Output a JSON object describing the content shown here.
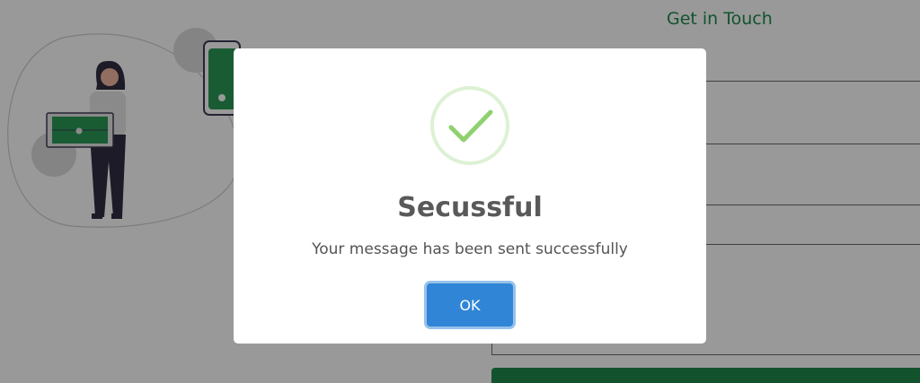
{
  "page": {
    "heading": "Get in Touch",
    "accent_color": "#1f8a4c",
    "illustration_icon": "person-with-laptop-illustration",
    "phone_icon": "phone-illustration"
  },
  "form": {
    "fields": [
      "name-field",
      "email-field",
      "subject-field",
      "message-field"
    ],
    "submit_color": "#1f8a4c"
  },
  "dialog": {
    "icon": "success-check-icon",
    "icon_color": "#8fd16f",
    "title": "Secussful",
    "message": "Your message has been sent successfully",
    "confirm_label": "OK",
    "confirm_color": "#3085d6"
  }
}
